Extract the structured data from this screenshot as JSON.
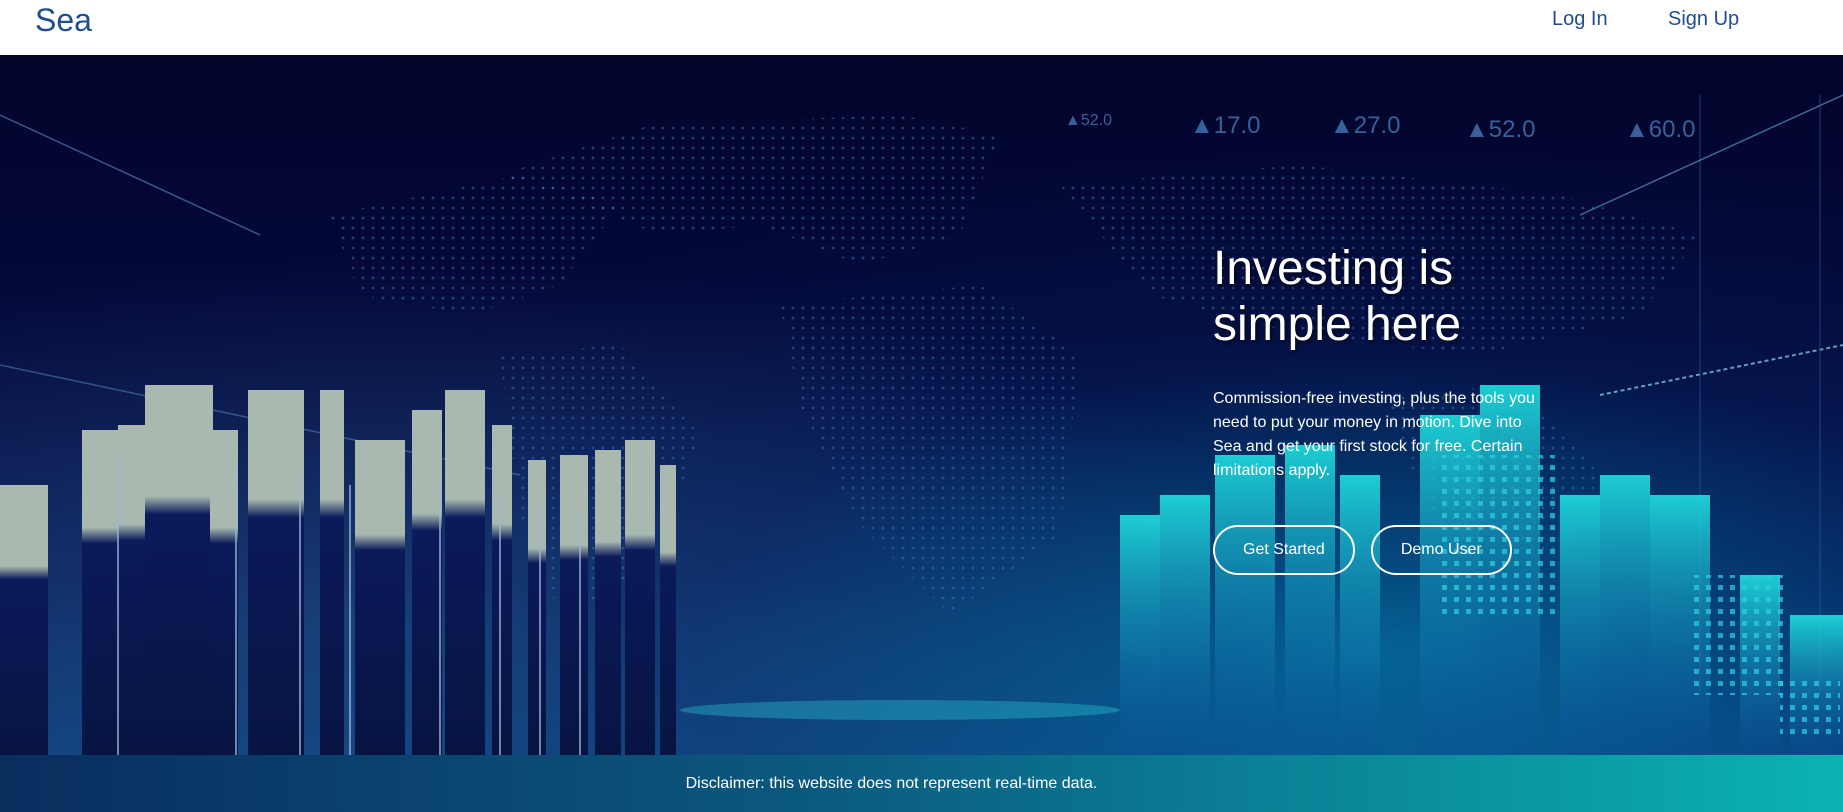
{
  "header": {
    "brand": "Sea",
    "login_label": "Log In",
    "signup_label": "Sign Up"
  },
  "hero": {
    "title": "Investing is simple here",
    "description": "Commission-free investing, plus the tools you need to put your money in motion. Dive into Sea and get your first stock for free. Certain limitations apply.",
    "get_started_label": "Get Started",
    "demo_user_label": "Demo User",
    "background_numbers": [
      "▲52.0",
      "▲17.0",
      "▲27.0",
      "▲52.0",
      "▲60.0"
    ]
  },
  "footer": {
    "disclaimer": "Disclaimer: this website does not represent real-time data."
  },
  "colors": {
    "brand": "#1f4e8c",
    "hero_dark": "#02042a",
    "accent_teal": "#0bb3b3"
  }
}
